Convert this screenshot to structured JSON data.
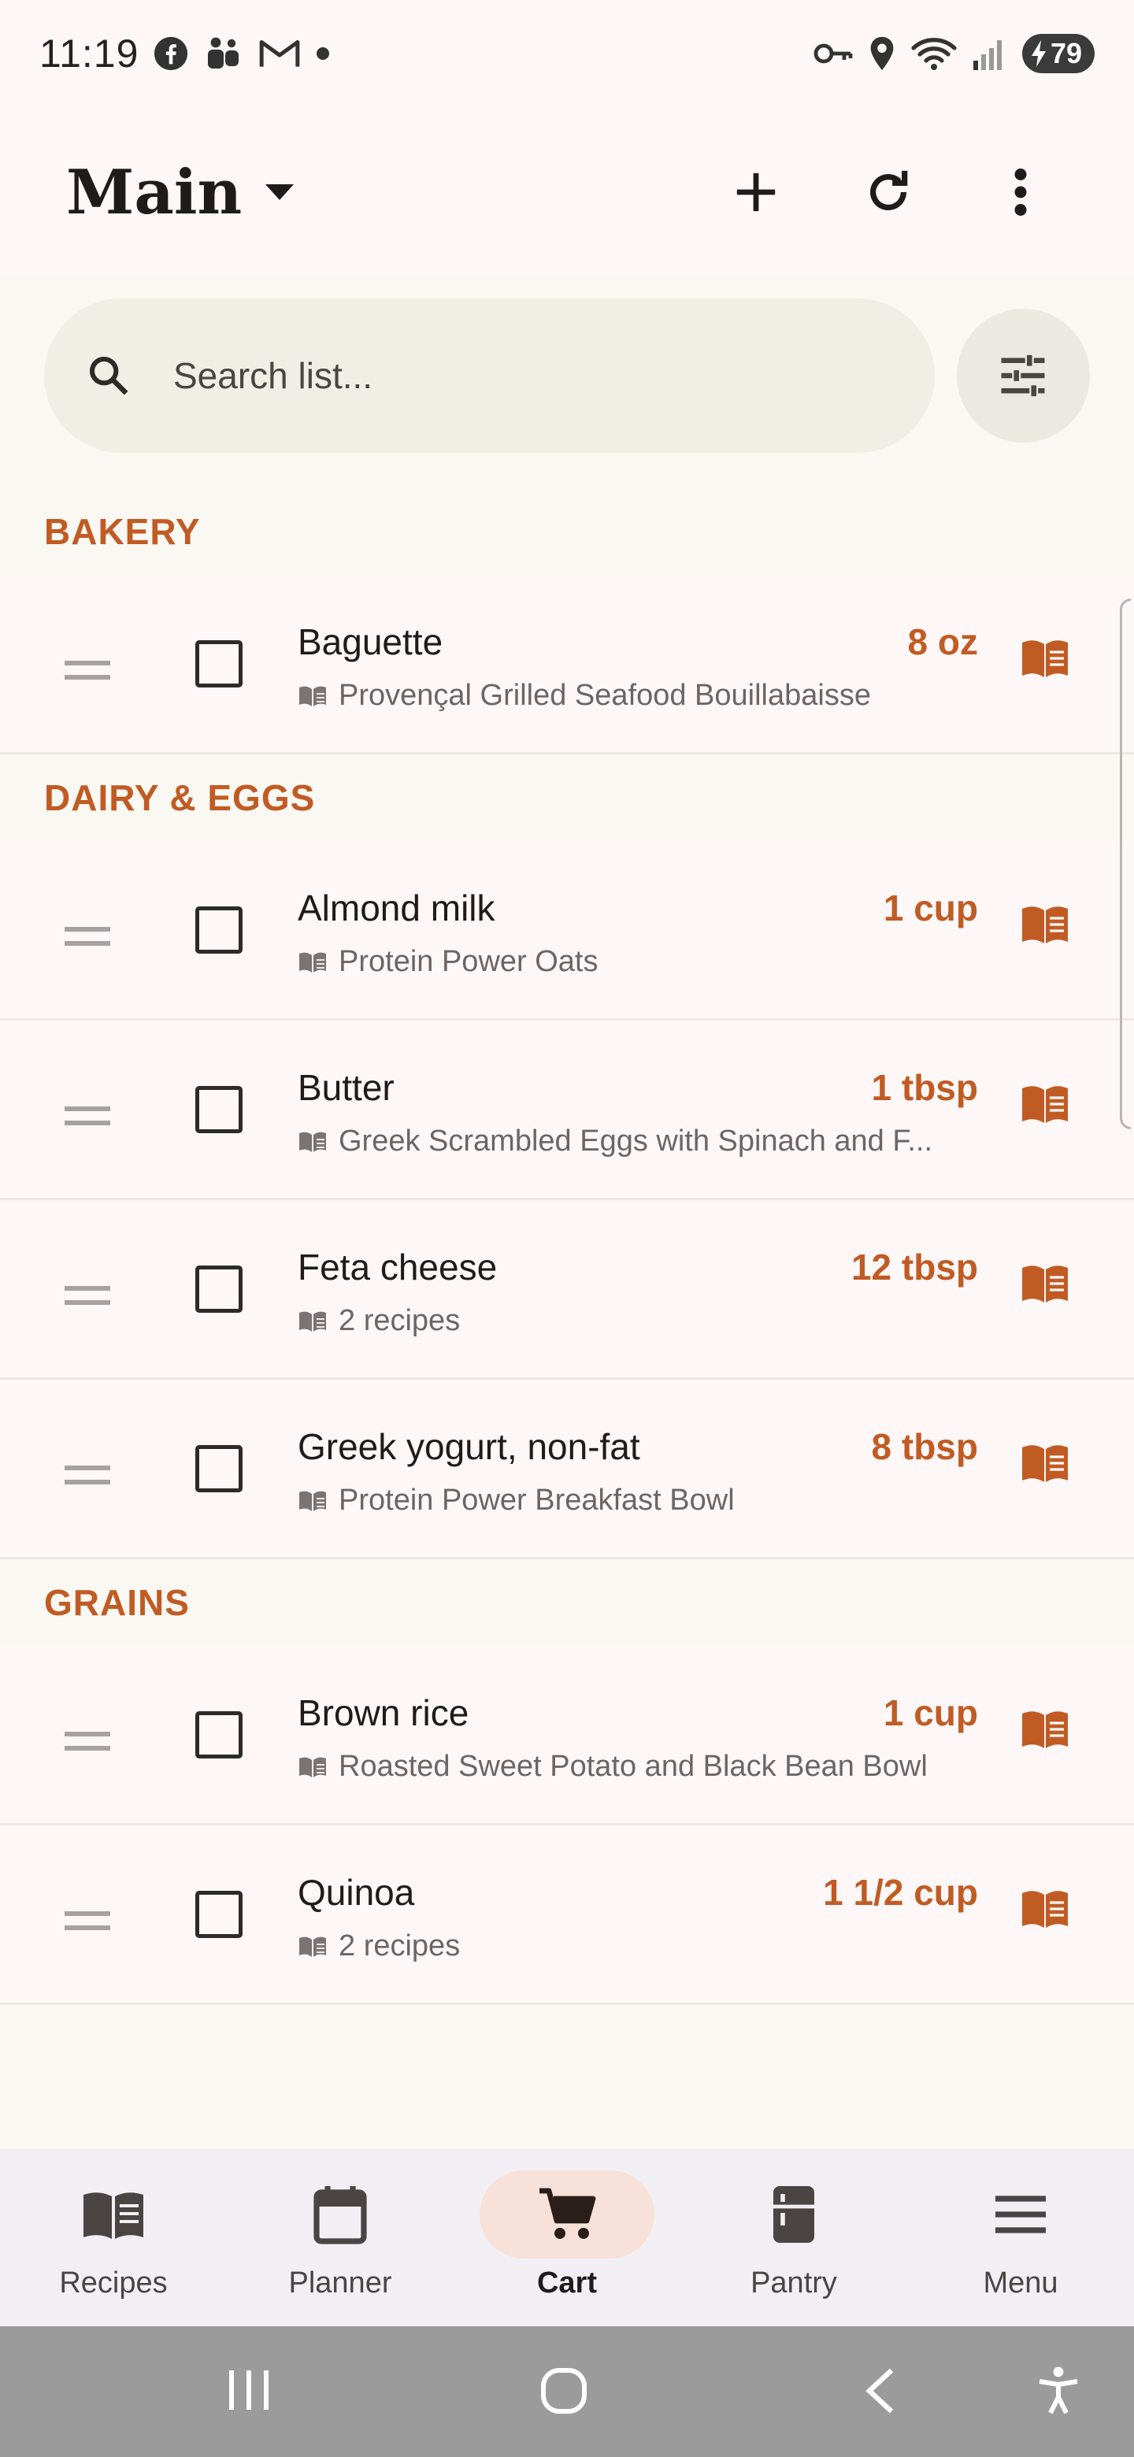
{
  "status_bar": {
    "time": "11:19",
    "battery": "79"
  },
  "header": {
    "title": "Main"
  },
  "search": {
    "placeholder": "Search list..."
  },
  "categories": [
    {
      "name": "BAKERY",
      "items": [
        {
          "name": "Baguette",
          "qty": "8 oz",
          "source": "Provençal Grilled Seafood Bouillabaisse"
        }
      ]
    },
    {
      "name": "DAIRY & EGGS",
      "items": [
        {
          "name": "Almond milk",
          "qty": "1 cup",
          "source": "Protein Power Oats"
        },
        {
          "name": "Butter",
          "qty": "1 tbsp",
          "source": "Greek Scrambled Eggs with Spinach and F..."
        },
        {
          "name": "Feta cheese",
          "qty": "12 tbsp",
          "source": "2 recipes"
        },
        {
          "name": "Greek yogurt, non-fat",
          "qty": "8 tbsp",
          "source": "Protein Power Breakfast Bowl"
        }
      ]
    },
    {
      "name": "GRAINS",
      "items": [
        {
          "name": "Brown rice",
          "qty": "1 cup",
          "source": "Roasted Sweet Potato and Black Bean Bowl"
        },
        {
          "name": "Quinoa",
          "qty": "1 1/2 cup",
          "source": "2 recipes"
        }
      ]
    }
  ],
  "bottom_nav": {
    "items": [
      {
        "label": "Recipes",
        "icon": "book-icon"
      },
      {
        "label": "Planner",
        "icon": "calendar-icon"
      },
      {
        "label": "Cart",
        "icon": "cart-icon"
      },
      {
        "label": "Pantry",
        "icon": "fridge-icon"
      },
      {
        "label": "Menu",
        "icon": "menu-icon"
      }
    ],
    "active": "Cart"
  },
  "colors": {
    "accent": "#c15b24",
    "active_nav_bg": "#f8e1d9",
    "background": "#f9f8f2",
    "card": "#fdf8f7"
  }
}
